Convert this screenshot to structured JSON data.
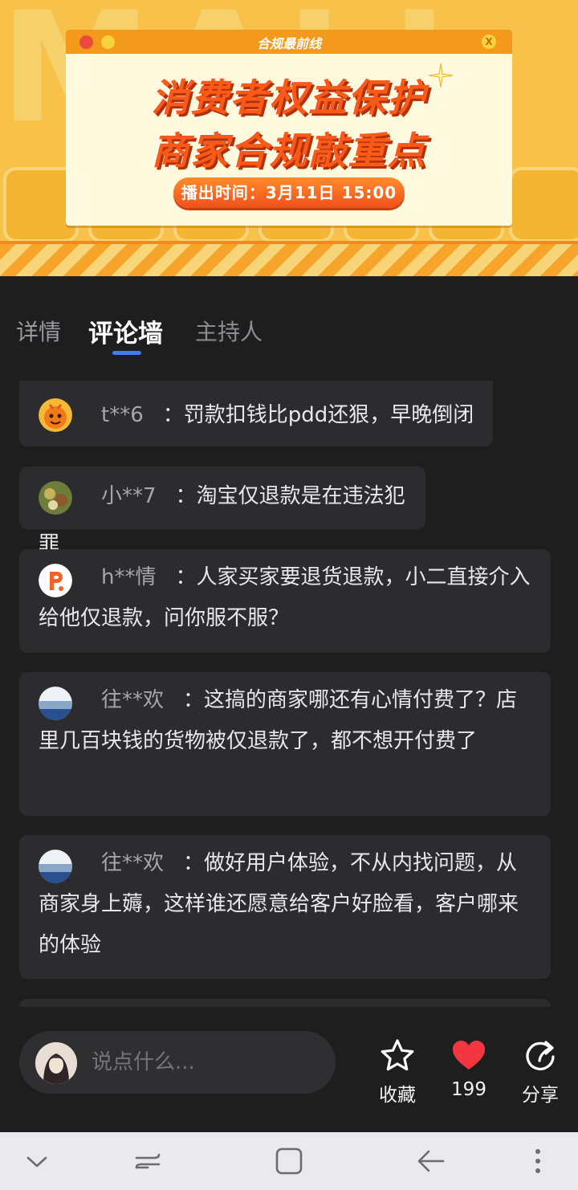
{
  "banner": {
    "bg_text": "MALL",
    "window_title": "合规最前线",
    "close_label": "X",
    "headline_1": "消费者权益保护",
    "headline_2": "商家合规敲重点",
    "air_time": "播出时间：3月11日 15:00",
    "colors": {
      "orange": "#f39a1d",
      "headline": "#fa5a17"
    }
  },
  "tabs": [
    {
      "label": "详情"
    },
    {
      "label": "评论墙",
      "active": true
    },
    {
      "label": "主持人"
    }
  ],
  "comments": [
    {
      "user": "t**6",
      "text": "罚款扣钱比pdd还狠，早晚倒闭",
      "avatar": "orange-mascot"
    },
    {
      "user": "小**7",
      "text": "淘宝仅退款是在违法犯罪",
      "avatar": "photo"
    },
    {
      "user": "h**情",
      "text": "人家买家要退货退款，小二直接介入给他仅退款，问你服不服？",
      "avatar": "p-logo"
    },
    {
      "user": "往**欢",
      "text": "这搞的商家哪还有心情付费了？店里几百块钱的货物被仅退款了，都不想开付费了",
      "avatar": "sea-photo"
    },
    {
      "user": "往**欢",
      "text": "做好用户体验，不从内找问题，从商家身上薅，这样谁还愿意给客户好脸看，客户哪来的体验",
      "avatar": "sea-photo"
    }
  ],
  "comment_separator": "：",
  "bottom": {
    "input_placeholder": "说点什么...",
    "favorite_label": "收藏",
    "like_count": "199",
    "share_label": "分享",
    "like_color": "#f2353f"
  },
  "navbar": {
    "icons": [
      "chevron-down-icon",
      "recent-apps-icon",
      "home-icon",
      "back-icon",
      "more-icon"
    ]
  }
}
